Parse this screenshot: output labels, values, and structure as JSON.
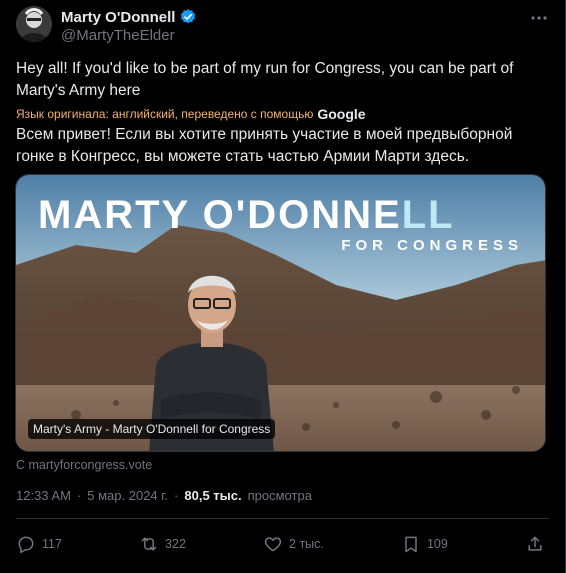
{
  "author": {
    "display_name": "Marty O'Donnell",
    "handle": "@MartyTheElder"
  },
  "tweet": {
    "text": "Hey all! If you'd like to be part of my run for Congress, you can be part of Marty's Army here",
    "translation_note": "Язык оригинала: английский, переведено с помощью",
    "translation_provider": "Google",
    "translated_text": "Всем привет! Если вы хотите принять участие в моей предвыборной гонке в Конгресс, вы можете стать частью Армии Марти здесь."
  },
  "media": {
    "banner_title_a": "MARTY O'DONNE",
    "banner_title_b": "LL",
    "banner_subtitle": "FOR CONGRESS",
    "caption": "Marty's Army - Marty O'Donnell for Congress"
  },
  "link": {
    "source": "С martyforcongress.vote"
  },
  "meta": {
    "time": "12:33 AM",
    "separator": "·",
    "date": "5 мар. 2024 г.",
    "separator2": "·",
    "views_count": "80,5 тыс.",
    "views_label": "просмотра"
  },
  "actions": {
    "replies": "117",
    "reposts": "322",
    "likes": "2 тыс.",
    "bookmarks": "109"
  },
  "colors": {
    "background": "#000000",
    "text": "#e7e9ea",
    "muted": "#71767b",
    "verified": "#1d9bf0",
    "translation": "#f4b36b"
  }
}
